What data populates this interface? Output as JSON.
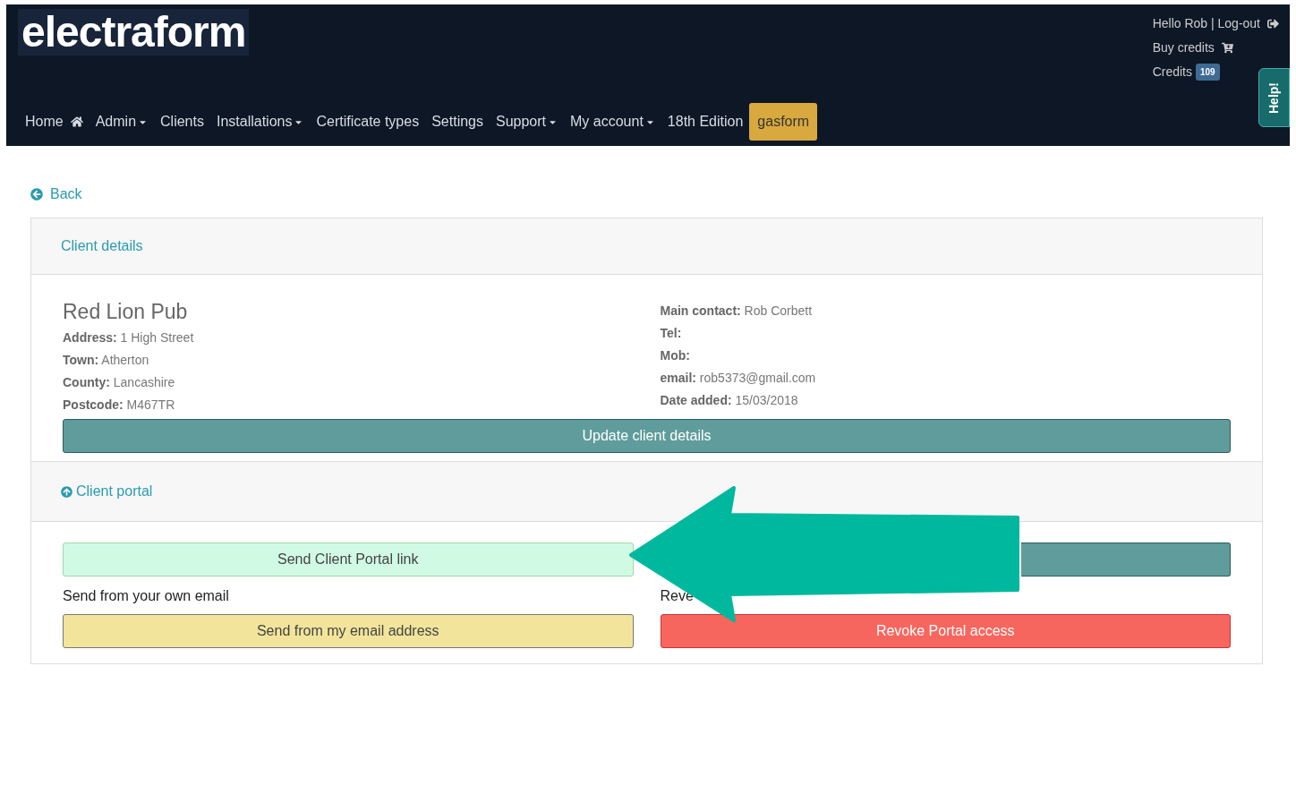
{
  "header": {
    "logo": "electraform",
    "user_links": {
      "greeting": "Hello Rob | Log-out",
      "buy": "Buy credits",
      "credits_label": "Credits",
      "credits_badge": "109"
    },
    "help_tab": "Help!"
  },
  "nav": [
    {
      "label": "Home",
      "kind": "home",
      "dropdown": false,
      "highlighted": false
    },
    {
      "label": "Admin",
      "dropdown": true,
      "highlighted": false
    },
    {
      "label": "Clients",
      "dropdown": false,
      "highlighted": false
    },
    {
      "label": "Installations",
      "dropdown": true,
      "highlighted": false
    },
    {
      "label": "Certificate types",
      "dropdown": false,
      "highlighted": false
    },
    {
      "label": "Settings",
      "dropdown": false,
      "highlighted": false
    },
    {
      "label": "Support",
      "dropdown": true,
      "highlighted": false
    },
    {
      "label": "My account",
      "dropdown": true,
      "highlighted": false
    },
    {
      "label": "18th Edition",
      "dropdown": false,
      "highlighted": false
    },
    {
      "label": "gasform",
      "dropdown": false,
      "highlighted": true
    }
  ],
  "back": "Back",
  "client_details": {
    "heading": "Client details",
    "name": "Red Lion Pub",
    "left": [
      {
        "label": "Address:",
        "value": "1 High Street"
      },
      {
        "label": "Town:",
        "value": "Atherton"
      },
      {
        "label": "County:",
        "value": "Lancashire"
      },
      {
        "label": "Postcode:",
        "value": "M467TR"
      }
    ],
    "right": [
      {
        "label": "Main contact:",
        "value": "Rob Corbett"
      },
      {
        "label": "Tel:"
      },
      {
        "label": "Mob:"
      },
      {
        "label": "email:",
        "value": "rob5373@gmail.com"
      },
      {
        "label": "Date added:",
        "value": "15/03/2018"
      }
    ],
    "update_button": "Update client details"
  },
  "client_portal": {
    "heading": "Client portal",
    "send_link_button": "Send Client Portal link",
    "own_email_label": "Send from your own email",
    "own_email_button": "Send from my email address",
    "revoke_label": "Reve",
    "revoke_button": "Revoke Portal access"
  }
}
